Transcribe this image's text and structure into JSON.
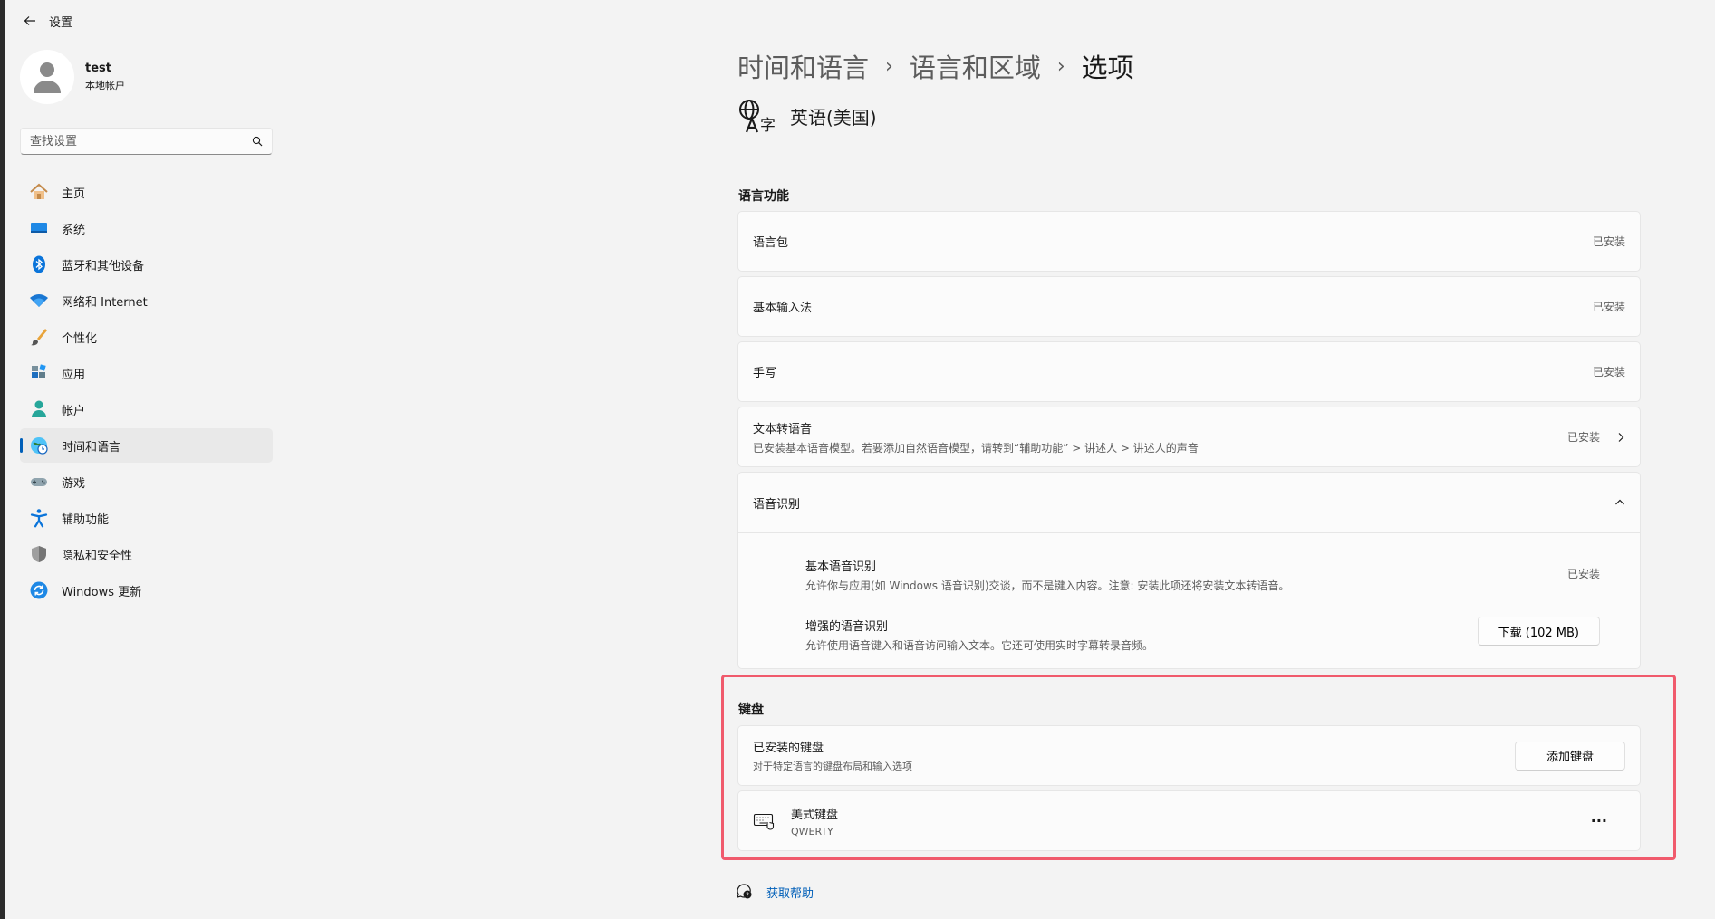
{
  "window": {
    "title": "设置"
  },
  "profile": {
    "name": "test",
    "account_type": "本地帐户"
  },
  "search": {
    "placeholder": "查找设置"
  },
  "nav": [
    {
      "label": "主页",
      "icon": "home-icon"
    },
    {
      "label": "系统",
      "icon": "system-icon"
    },
    {
      "label": "蓝牙和其他设备",
      "icon": "bluetooth-icon"
    },
    {
      "label": "网络和 Internet",
      "icon": "wifi-icon"
    },
    {
      "label": "个性化",
      "icon": "brush-icon"
    },
    {
      "label": "应用",
      "icon": "apps-icon"
    },
    {
      "label": "帐户",
      "icon": "account-icon"
    },
    {
      "label": "时间和语言",
      "icon": "time-language-icon",
      "active": true
    },
    {
      "label": "游戏",
      "icon": "gamepad-icon"
    },
    {
      "label": "辅助功能",
      "icon": "accessibility-icon"
    },
    {
      "label": "隐私和安全性",
      "icon": "shield-icon"
    },
    {
      "label": "Windows 更新",
      "icon": "update-icon"
    }
  ],
  "breadcrumb": {
    "first": "时间和语言",
    "second": "语言和区域",
    "current": "选项",
    "separator": "›"
  },
  "language": {
    "name": "英语(美国)",
    "icon": "language-icon"
  },
  "features": {
    "title": "语言功能",
    "language_pack": {
      "label": "语言包",
      "status": "已安装"
    },
    "basic_input": {
      "label": "基本输入法",
      "status": "已安装"
    },
    "handwriting": {
      "label": "手写",
      "status": "已安装"
    },
    "tts": {
      "label": "文本转语音",
      "description": "已安装基本语音模型。若要添加自然语音模型，请转到“辅助功能” > 讲述人 > 讲述人的声音",
      "status": "已安装"
    },
    "speech": {
      "label": "语音识别",
      "basic": {
        "label": "基本语音识别",
        "description": "允许你与应用(如 Windows 语音识别)交谈，而不是键入内容。注意: 安装此项还将安装文本转语音。",
        "status": "已安装"
      },
      "enhanced": {
        "label": "增强的语音识别",
        "description": "允许使用语音键入和语音访问输入文本。它还可使用实时字幕转录音频。",
        "button": "下载 (102 MB)"
      }
    }
  },
  "keyboard": {
    "title": "键盘",
    "installed": {
      "label": "已安装的键盘",
      "description": "对于特定语言的键盘布局和输入选项",
      "button": "添加键盘"
    },
    "item": {
      "name": "美式键盘",
      "layout": "QWERTY",
      "more": "···"
    }
  },
  "help": {
    "label": "获取帮助"
  },
  "colors": {
    "accent": "#005fb8",
    "highlight": "#f05a6c",
    "background": "#f3f3f3",
    "card": "#fbfbfb"
  }
}
